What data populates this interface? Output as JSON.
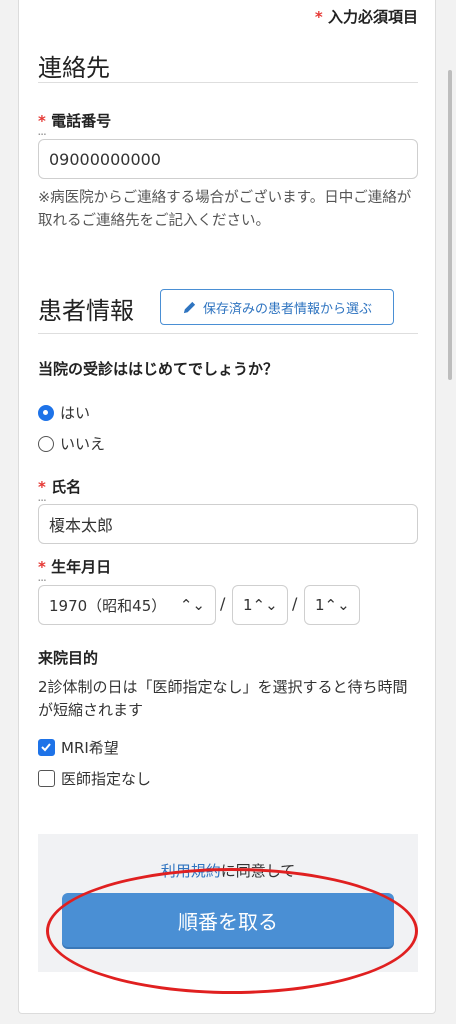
{
  "required_legend": {
    "mark": "*",
    "text": "入力必須項目"
  },
  "contact": {
    "section_title": "連絡先",
    "phone_label": "電話番号",
    "phone_value": "09000000000",
    "note": "※病医院からご連絡する場合がございます。日中ご連絡が取れるご連絡先をご記入ください。"
  },
  "patient": {
    "section_title": "患者情報",
    "choose_saved_label": "保存済みの患者情報から選ぶ",
    "first_visit_question": "当院の受診ははじめてでしょうか？",
    "first_visit_options": [
      {
        "label": "はい",
        "selected": true
      },
      {
        "label": "いいえ",
        "selected": false
      }
    ],
    "name_label": "氏名",
    "name_placeholder": "榎本太郎",
    "birth_label": "生年月日",
    "birth_year": "1970（昭和45）",
    "birth_month": "1",
    "birth_day": "1",
    "date_sep": "/",
    "purpose_label": "来院目的",
    "purpose_note": "2診体制の日は「医師指定なし」を選択すると待ち時間が短縮されます",
    "purpose_options": [
      {
        "label": "MRI希望",
        "checked": true
      },
      {
        "label": "医師指定なし",
        "checked": false
      }
    ]
  },
  "footer": {
    "terms_link": "利用規約",
    "agree_text": "に同意して",
    "submit_label": "順番を取る"
  },
  "colors": {
    "accent": "#4a8fd4",
    "required": "#e53935",
    "annotation": "#e02020"
  }
}
